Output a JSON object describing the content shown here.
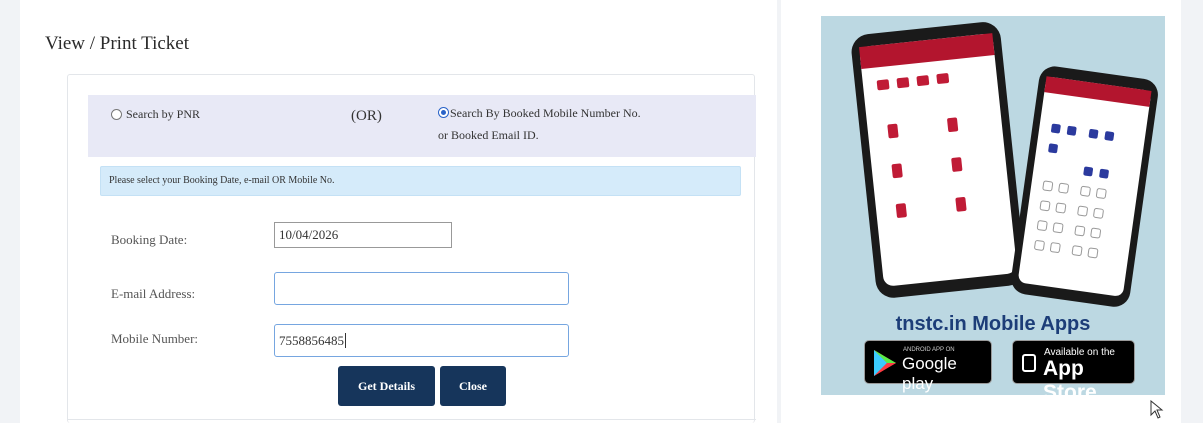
{
  "page": {
    "title": "View / Print Ticket"
  },
  "search_options": {
    "pnr_label": "Search by PNR",
    "or_label": "(OR)",
    "mobile_email_line1": "Search By Booked Mobile Number No.",
    "mobile_email_line2": "or Booked Email ID.",
    "selected": "mobile_email"
  },
  "info": {
    "message": "Please select your Booking Date, e-mail OR Mobile No."
  },
  "form": {
    "booking_date_label": "Booking Date:",
    "booking_date_value": "10/04/2026",
    "email_label": "E-mail Address:",
    "email_value": "",
    "mobile_label": "Mobile Number:",
    "mobile_value": "7558856485"
  },
  "buttons": {
    "get_details": "Get Details",
    "close": "Close"
  },
  "ad": {
    "title": "tnstc.in Mobile Apps",
    "google_play_small": "ANDROID APP ON",
    "google_play_big": "Google play",
    "app_store_small": "Available on the",
    "app_store_big": "App Store"
  },
  "colors": {
    "primary_button": "#16355b",
    "option_bar": "#e8e9f6",
    "info_bar": "#d5ebfa",
    "input_focus_border": "#76a6e0",
    "ad_background": "#bcd8e2",
    "ad_title": "#1c3d78"
  }
}
